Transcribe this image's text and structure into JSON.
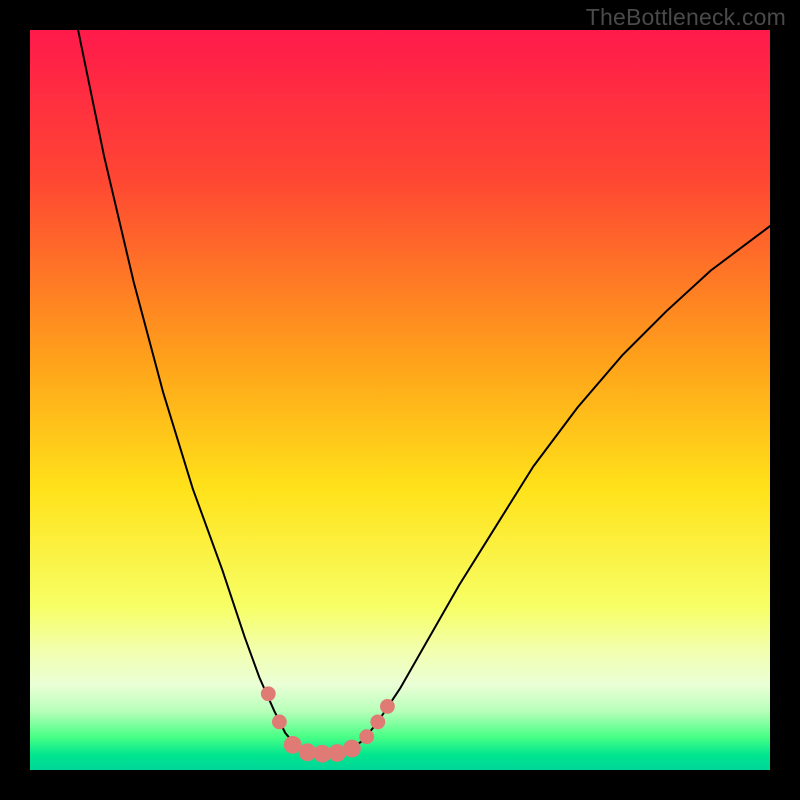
{
  "watermark": "TheBottleneck.com",
  "chart_data": {
    "type": "line",
    "title": "",
    "xlabel": "",
    "ylabel": "",
    "xlim": [
      0,
      100
    ],
    "ylim": [
      0,
      100
    ],
    "gradient_stops": [
      {
        "offset": 0.0,
        "color": "#ff1a4b"
      },
      {
        "offset": 0.2,
        "color": "#ff4633"
      },
      {
        "offset": 0.45,
        "color": "#ffa31a"
      },
      {
        "offset": 0.62,
        "color": "#ffe21a"
      },
      {
        "offset": 0.78,
        "color": "#f7ff66"
      },
      {
        "offset": 0.84,
        "color": "#f2ffb0"
      },
      {
        "offset": 0.885,
        "color": "#eaffd6"
      },
      {
        "offset": 0.92,
        "color": "#b8ffba"
      },
      {
        "offset": 0.955,
        "color": "#49ff86"
      },
      {
        "offset": 0.98,
        "color": "#00e58f"
      },
      {
        "offset": 1.0,
        "color": "#00d69a"
      }
    ],
    "series": [
      {
        "name": "curve",
        "points": [
          {
            "x": 6.5,
            "y": 100.0
          },
          {
            "x": 10.0,
            "y": 83.0
          },
          {
            "x": 14.0,
            "y": 66.0
          },
          {
            "x": 18.0,
            "y": 51.0
          },
          {
            "x": 22.0,
            "y": 38.0
          },
          {
            "x": 26.0,
            "y": 27.0
          },
          {
            "x": 29.0,
            "y": 18.0
          },
          {
            "x": 31.0,
            "y": 12.5
          },
          {
            "x": 33.0,
            "y": 8.0
          },
          {
            "x": 34.5,
            "y": 5.0
          },
          {
            "x": 36.0,
            "y": 3.2
          },
          {
            "x": 37.5,
            "y": 2.4
          },
          {
            "x": 39.0,
            "y": 2.2
          },
          {
            "x": 41.0,
            "y": 2.2
          },
          {
            "x": 43.0,
            "y": 2.6
          },
          {
            "x": 45.0,
            "y": 4.0
          },
          {
            "x": 47.0,
            "y": 6.5
          },
          {
            "x": 50.0,
            "y": 11.0
          },
          {
            "x": 54.0,
            "y": 18.0
          },
          {
            "x": 58.0,
            "y": 25.0
          },
          {
            "x": 63.0,
            "y": 33.0
          },
          {
            "x": 68.0,
            "y": 41.0
          },
          {
            "x": 74.0,
            "y": 49.0
          },
          {
            "x": 80.0,
            "y": 56.0
          },
          {
            "x": 86.0,
            "y": 62.0
          },
          {
            "x": 92.0,
            "y": 67.5
          },
          {
            "x": 98.0,
            "y": 72.0
          },
          {
            "x": 100.0,
            "y": 73.5
          }
        ]
      }
    ],
    "markers": [
      {
        "x": 32.2,
        "y": 10.3,
        "r": 1.0
      },
      {
        "x": 33.7,
        "y": 6.5,
        "r": 1.0
      },
      {
        "x": 35.5,
        "y": 3.4,
        "r": 1.2
      },
      {
        "x": 37.5,
        "y": 2.4,
        "r": 1.2
      },
      {
        "x": 39.5,
        "y": 2.2,
        "r": 1.2
      },
      {
        "x": 41.5,
        "y": 2.3,
        "r": 1.2
      },
      {
        "x": 43.5,
        "y": 2.9,
        "r": 1.2
      },
      {
        "x": 45.5,
        "y": 4.5,
        "r": 1.0
      },
      {
        "x": 47.0,
        "y": 6.5,
        "r": 1.0
      },
      {
        "x": 48.3,
        "y": 8.6,
        "r": 1.0
      }
    ],
    "marker_color": "#e07a74",
    "curve_color": "#000000",
    "curve_width": 2
  }
}
